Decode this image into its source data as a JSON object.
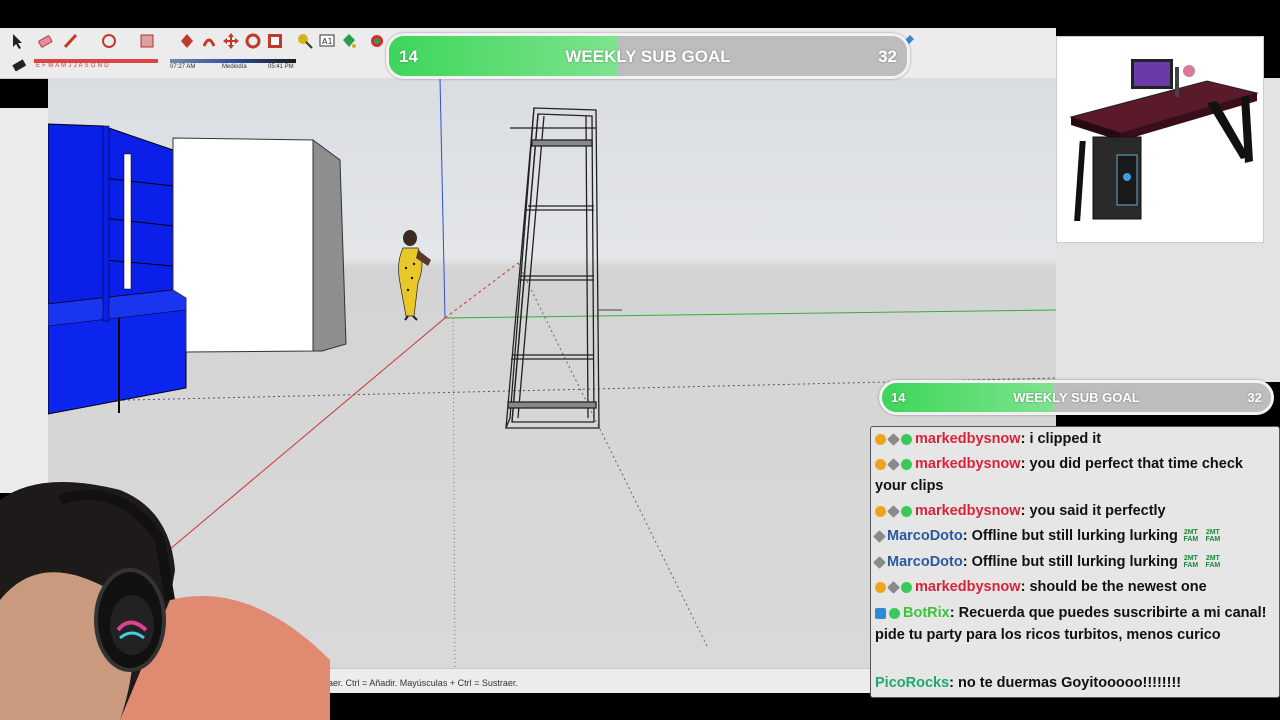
{
  "toolbar": {
    "months": "E F M A M J J A S O N D",
    "time_left": "07:27 AM",
    "time_mid": "Mediodía",
    "time_right": "05:41 PM"
  },
  "status_bar": {
    "hint": "Sustraer. Ctrl = Añadir. Mayúsculas + Ctrl = Sustraer."
  },
  "goal_top": {
    "current": "14",
    "label": "WEEKLY SUB GOAL",
    "target": "32",
    "progress": 0.44
  },
  "goal_side": {
    "current": "14",
    "label": "WEEKLY SUB GOAL",
    "target": "32",
    "progress": 0.44
  },
  "chat": {
    "messages": [
      {
        "user": "markedbysnow",
        "text": "i clipped it"
      },
      {
        "user": "markedbysnow",
        "text": "you did perfect that time check your clips"
      },
      {
        "user": "markedbysnow",
        "text": "you said it perfectly"
      },
      {
        "user": "MarcoDoto",
        "text": "Offline but still lurking lurking"
      },
      {
        "user": "MarcoDoto",
        "text": "Offline but still lurking lurking"
      },
      {
        "user": "markedbysnow",
        "text": "should be the newest one"
      },
      {
        "user": "BotRix",
        "text": "Recuerda que puedes suscribirte a mi canal! pide tu party para los ricos turbitos, menos curico"
      },
      {
        "user": "PicoRocks",
        "text": "no te duermas Goyitooooo!!!!!!!!"
      }
    ],
    "emote_label": "2MT FAM"
  },
  "colors": {
    "goal_fill": "#3dd65a",
    "chat_red": "#d8243a",
    "chat_blue": "#2c58a0",
    "chat_green": "#3cc43c",
    "axis_green": "#35b035",
    "axis_red": "#d03030",
    "axis_blue": "#3050c8"
  },
  "icons": [
    "select-arrow-icon",
    "eraser-icon",
    "pencil-icon",
    "shape-icon",
    "paint-bucket-icon",
    "move-icon",
    "rotate-icon",
    "scale-icon",
    "orbit-icon",
    "zoom-icon",
    "tape-measure-icon"
  ]
}
